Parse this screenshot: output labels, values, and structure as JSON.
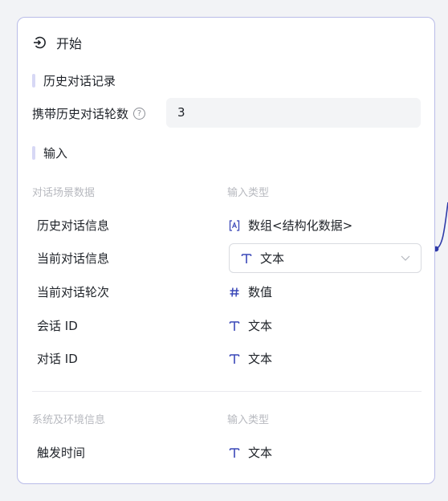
{
  "node": {
    "title": "开始",
    "icon": "login-icon"
  },
  "history": {
    "section_title": "历史对话记录",
    "rounds_label": "携带历史对话轮数",
    "rounds_value": "3",
    "help_symbol": "?"
  },
  "inputs": {
    "section_title": "输入",
    "group1": {
      "header_name": "对话场景数据",
      "header_type": "输入类型",
      "rows": [
        {
          "name": "历史对话信息",
          "type": "数组<结构化数据>",
          "icon": "array-icon"
        },
        {
          "name": "当前对话信息",
          "type": "文本",
          "icon": "text-type-icon",
          "dropdown": true
        },
        {
          "name": "当前对话轮次",
          "type": "数值",
          "icon": "number-icon"
        },
        {
          "name": "会话 ID",
          "type": "文本",
          "icon": "text-type-icon"
        },
        {
          "name": "对话 ID",
          "type": "文本",
          "icon": "text-type-icon"
        }
      ]
    },
    "group2": {
      "header_name": "系统及环境信息",
      "header_type": "输入类型",
      "rows": [
        {
          "name": "触发时间",
          "type": "文本",
          "icon": "text-type-icon"
        }
      ]
    }
  },
  "colors": {
    "card_border": "#b9bce8",
    "accent": "#3a48b8",
    "section_bar": "#d7d8f5",
    "muted_text": "#b7b9bf"
  }
}
